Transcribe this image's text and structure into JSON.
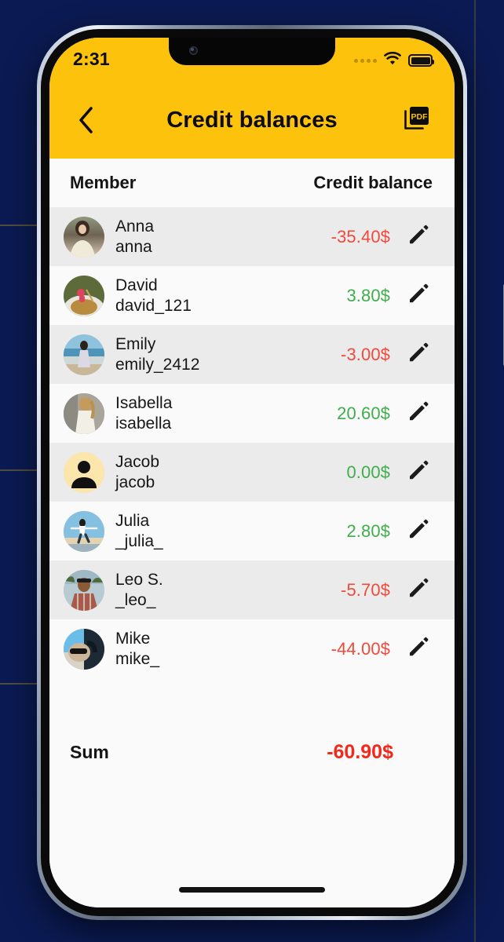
{
  "status_bar": {
    "time": "2:31",
    "signal_icon": "signal-dots-icon",
    "wifi_icon": "wifi-icon",
    "battery_icon": "battery-full-icon"
  },
  "nav": {
    "back_icon": "chevron-left-icon",
    "title": "Credit balances",
    "pdf_label": "PDF",
    "pdf_icon": "pdf-export-icon"
  },
  "table": {
    "headers": {
      "member": "Member",
      "balance": "Credit balance"
    },
    "edit_icon": "pencil-icon",
    "rows": [
      {
        "name": "Anna",
        "handle": "anna",
        "amount": "-35.40$",
        "sign": "neg",
        "avatar": "photo-anna"
      },
      {
        "name": "David",
        "handle": "david_121",
        "amount": "3.80$",
        "sign": "pos",
        "avatar": "photo-david"
      },
      {
        "name": "Emily",
        "handle": "emily_2412",
        "amount": "-3.00$",
        "sign": "neg",
        "avatar": "photo-emily"
      },
      {
        "name": "Isabella",
        "handle": "isabella",
        "amount": "20.60$",
        "sign": "pos",
        "avatar": "photo-isabella"
      },
      {
        "name": "Jacob",
        "handle": "jacob",
        "amount": "0.00$",
        "sign": "pos",
        "avatar": "placeholder-person"
      },
      {
        "name": "Julia",
        "handle": "_julia_",
        "amount": "2.80$",
        "sign": "pos",
        "avatar": "photo-julia"
      },
      {
        "name": "Leo S.",
        "handle": "_leo_",
        "amount": "-5.70$",
        "sign": "neg",
        "avatar": "photo-leo"
      },
      {
        "name": "Mike",
        "handle": "mike_",
        "amount": "-44.00$",
        "sign": "neg",
        "avatar": "photo-mike"
      }
    ]
  },
  "summary": {
    "label": "Sum",
    "value": "-60.90$"
  },
  "colors": {
    "brand_yellow": "#FCC20C",
    "negative": "#F04A3B",
    "positive": "#3FAE4B",
    "sum_negative": "#F3281B",
    "row_alt": "#EBEBEB",
    "row_base": "#FAFAFA",
    "backdrop": "#0B1A52"
  }
}
